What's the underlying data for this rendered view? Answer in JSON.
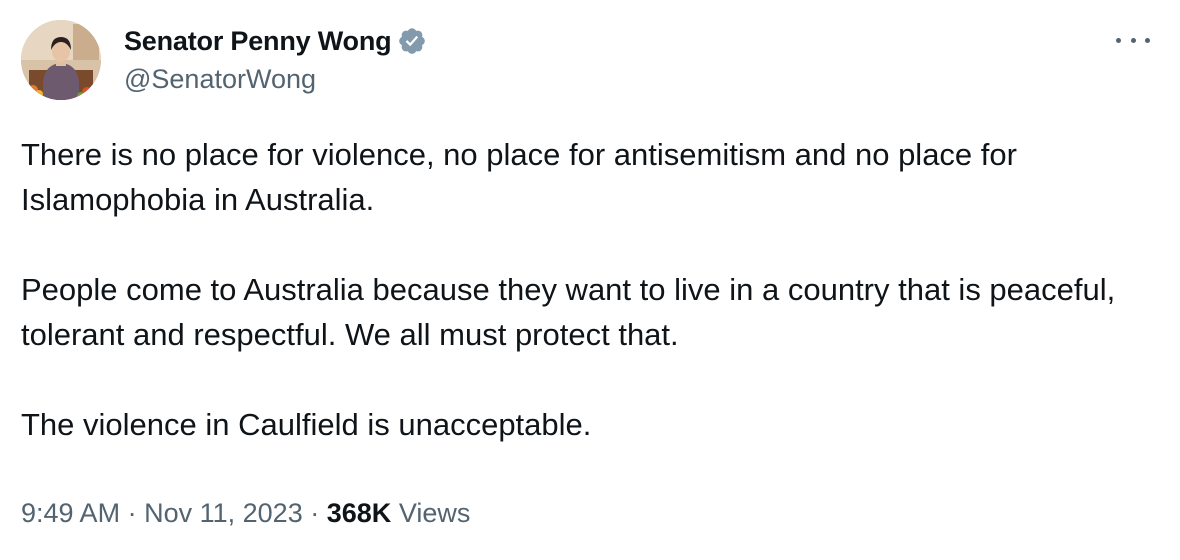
{
  "author": {
    "display_name": "Senator Penny Wong",
    "handle": "@SenatorWong",
    "verified_icon": "verified-badge-icon",
    "verified_color": "#829aab"
  },
  "menu": {
    "icon": "more-options-icon"
  },
  "tweet": {
    "paragraphs": [
      "There is no place for violence, no place for antisemitism and no place for Islamophobia in Australia.",
      "People come to Australia because they want to live in a country that is peaceful, tolerant and respectful. We all must protect that.",
      "The violence in Caulfield is unacceptable."
    ]
  },
  "meta": {
    "time": "9:49 AM",
    "separator": "·",
    "date": "Nov 11, 2023",
    "views_count": "368K",
    "views_label": "Views"
  },
  "colors": {
    "text": "#0f1419",
    "secondary": "#536471",
    "background": "#ffffff"
  }
}
